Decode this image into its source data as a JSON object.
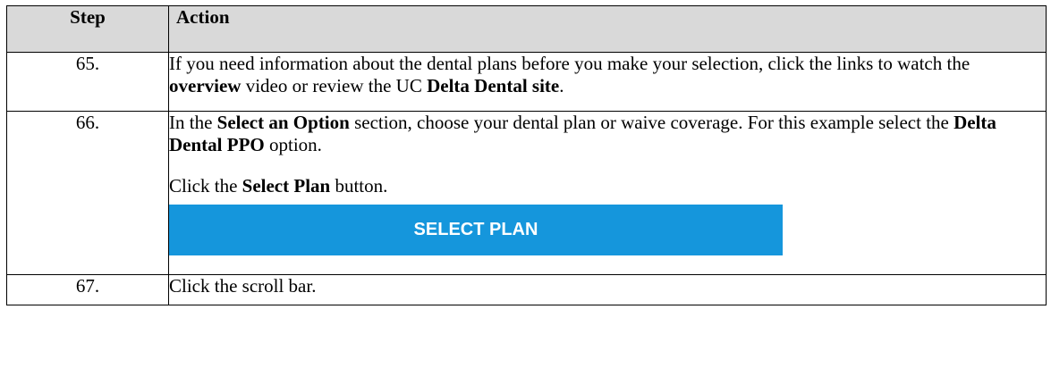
{
  "table": {
    "headers": {
      "step": "Step",
      "action": "Action"
    },
    "rows": [
      {
        "step": "65.",
        "action": {
          "t1": "If you need information about the dental plans before you make your selection, click the links to watch the ",
          "b1": "overview",
          "t2": " video or review the UC ",
          "b2": "Delta Dental site",
          "t3": "."
        }
      },
      {
        "step": "66.",
        "action": {
          "t1": "In the ",
          "b1": "Select an Option",
          "t2": " section, choose your dental plan or waive coverage. For this example select the ",
          "b2": "Delta Dental PPO",
          "t3": " option.",
          "p2_t1": "Click the ",
          "p2_b1": "Select Plan",
          "p2_t2": " button.",
          "button_label": "SELECT PLAN"
        }
      },
      {
        "step": "67.",
        "action": {
          "t1": "Click the scroll bar."
        }
      }
    ]
  },
  "colors": {
    "header_bg": "#d9d9d9",
    "button_bg": "#1596dc",
    "button_text": "#ffffff"
  }
}
